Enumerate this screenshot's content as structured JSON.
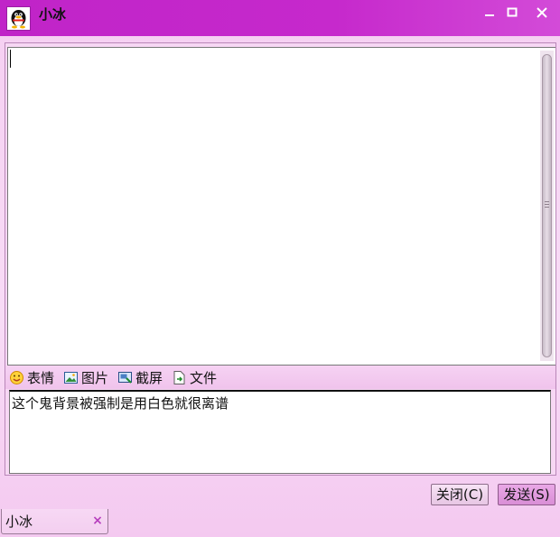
{
  "window": {
    "title": "小冰",
    "controls": {
      "minimize_icon": "minimize-icon",
      "maximize_icon": "maximize-icon",
      "close_icon": "close-icon"
    }
  },
  "toolbar": {
    "items": [
      {
        "label": "表情",
        "icon": "emoji-icon"
      },
      {
        "label": "图片",
        "icon": "image-icon"
      },
      {
        "label": "截屏",
        "icon": "screenshot-icon"
      },
      {
        "label": "文件",
        "icon": "file-icon"
      }
    ]
  },
  "input": {
    "value": "这个鬼背景被强制是用白色就很离谱"
  },
  "buttons": {
    "close_label": "关闭(C)",
    "send_label": "发送(S)"
  },
  "tabs": [
    {
      "label": "小冰",
      "close_glyph": "×"
    }
  ],
  "colors": {
    "titlebar": "#c629cc",
    "background": "#f8dcf6",
    "send_button": "#e19be0"
  }
}
